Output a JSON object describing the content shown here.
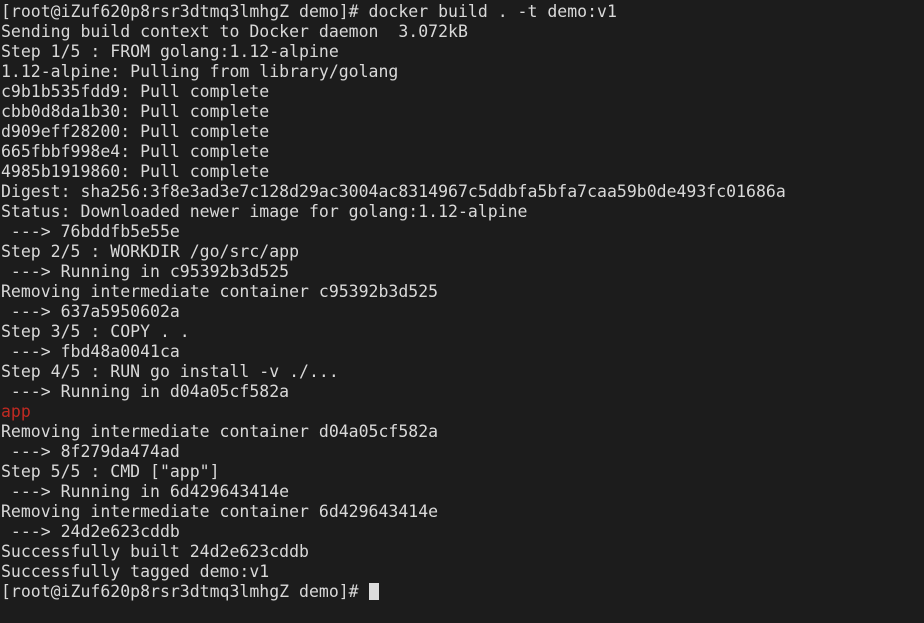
{
  "terminal": {
    "background_color": "#1c1c1c",
    "foreground_color": "#d9d9d9",
    "red_color": "#c02a22",
    "cursor_color": "#dcdcdc",
    "prompt": "[root@iZuf620p8rsr3dtmq3lmhgZ demo]# ",
    "command": "docker build . -t demo:v1",
    "lines": [
      {
        "text": "[root@iZuf620p8rsr3dtmq3lmhgZ demo]# docker build . -t demo:v1",
        "color": "default"
      },
      {
        "text": "Sending build context to Docker daemon  3.072kB",
        "color": "default"
      },
      {
        "text": "Step 1/5 : FROM golang:1.12-alpine",
        "color": "default"
      },
      {
        "text": "1.12-alpine: Pulling from library/golang",
        "color": "default"
      },
      {
        "text": "c9b1b535fdd9: Pull complete",
        "color": "default"
      },
      {
        "text": "cbb0d8da1b30: Pull complete",
        "color": "default"
      },
      {
        "text": "d909eff28200: Pull complete",
        "color": "default"
      },
      {
        "text": "665fbbf998e4: Pull complete",
        "color": "default"
      },
      {
        "text": "4985b1919860: Pull complete",
        "color": "default"
      },
      {
        "text": "Digest: sha256:3f8e3ad3e7c128d29ac3004ac8314967c5ddbfa5bfa7caa59b0de493fc01686a",
        "color": "default"
      },
      {
        "text": "Status: Downloaded newer image for golang:1.12-alpine",
        "color": "default"
      },
      {
        "text": " ---> 76bddfb5e55e",
        "color": "default"
      },
      {
        "text": "Step 2/5 : WORKDIR /go/src/app",
        "color": "default"
      },
      {
        "text": " ---> Running in c95392b3d525",
        "color": "default"
      },
      {
        "text": "Removing intermediate container c95392b3d525",
        "color": "default"
      },
      {
        "text": " ---> 637a5950602a",
        "color": "default"
      },
      {
        "text": "Step 3/5 : COPY . .",
        "color": "default"
      },
      {
        "text": " ---> fbd48a0041ca",
        "color": "default"
      },
      {
        "text": "Step 4/5 : RUN go install -v ./...",
        "color": "default"
      },
      {
        "text": " ---> Running in d04a05cf582a",
        "color": "default"
      },
      {
        "text": "app",
        "color": "red"
      },
      {
        "text": "Removing intermediate container d04a05cf582a",
        "color": "default"
      },
      {
        "text": " ---> 8f279da474ad",
        "color": "default"
      },
      {
        "text": "Step 5/5 : CMD [\"app\"]",
        "color": "default"
      },
      {
        "text": " ---> Running in 6d429643414e",
        "color": "default"
      },
      {
        "text": "Removing intermediate container 6d429643414e",
        "color": "default"
      },
      {
        "text": " ---> 24d2e623cddb",
        "color": "default"
      },
      {
        "text": "Successfully built 24d2e623cddb",
        "color": "default"
      },
      {
        "text": "Successfully tagged demo:v1",
        "color": "default"
      }
    ],
    "prompt_line": {
      "text": "[root@iZuf620p8rsr3dtmq3lmhgZ demo]# ",
      "cursor": "block-cursor"
    }
  }
}
